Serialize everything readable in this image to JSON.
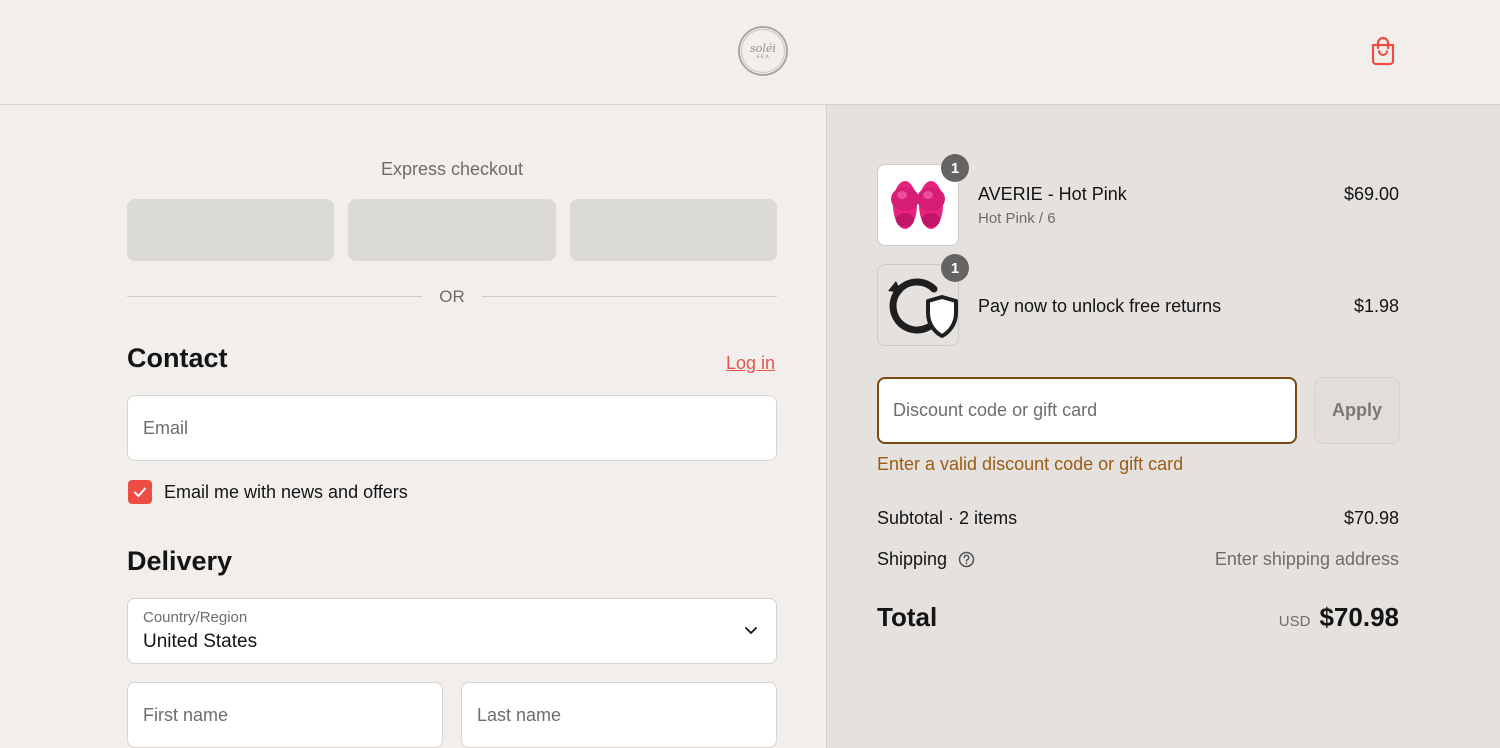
{
  "header": {
    "logo_text": "soléi",
    "logo_subtext": "SEA",
    "bag_icon": "shopping-bag-icon",
    "accent_color": "#ee4d44"
  },
  "express": {
    "title": "Express checkout",
    "or_text": "OR"
  },
  "contact": {
    "heading": "Contact",
    "login_label": "Log in",
    "email_placeholder": "Email",
    "newsletter_label": "Email me with news and offers",
    "newsletter_checked": true
  },
  "delivery": {
    "heading": "Delivery",
    "country_label": "Country/Region",
    "country_value": "United States",
    "first_name_placeholder": "First name",
    "last_name_placeholder": "Last name"
  },
  "order": {
    "items": [
      {
        "name": "AVERIE - Hot Pink",
        "variant": "Hot Pink / 6",
        "price": "$69.00",
        "quantity": "1",
        "image": "pink-slippers-image"
      },
      {
        "name": "Pay now to unlock free returns",
        "variant": "",
        "price": "$1.98",
        "quantity": "1",
        "image": "returns-shield-icon"
      }
    ],
    "discount_placeholder": "Discount code or gift card",
    "apply_label": "Apply",
    "discount_error": "Enter a valid discount code or gift card",
    "subtotal_label": "Subtotal · 2 items",
    "subtotal_value": "$70.98",
    "shipping_label": "Shipping",
    "shipping_value": "Enter shipping address",
    "total_label": "Total",
    "total_currency": "USD",
    "total_value": "$70.98"
  }
}
